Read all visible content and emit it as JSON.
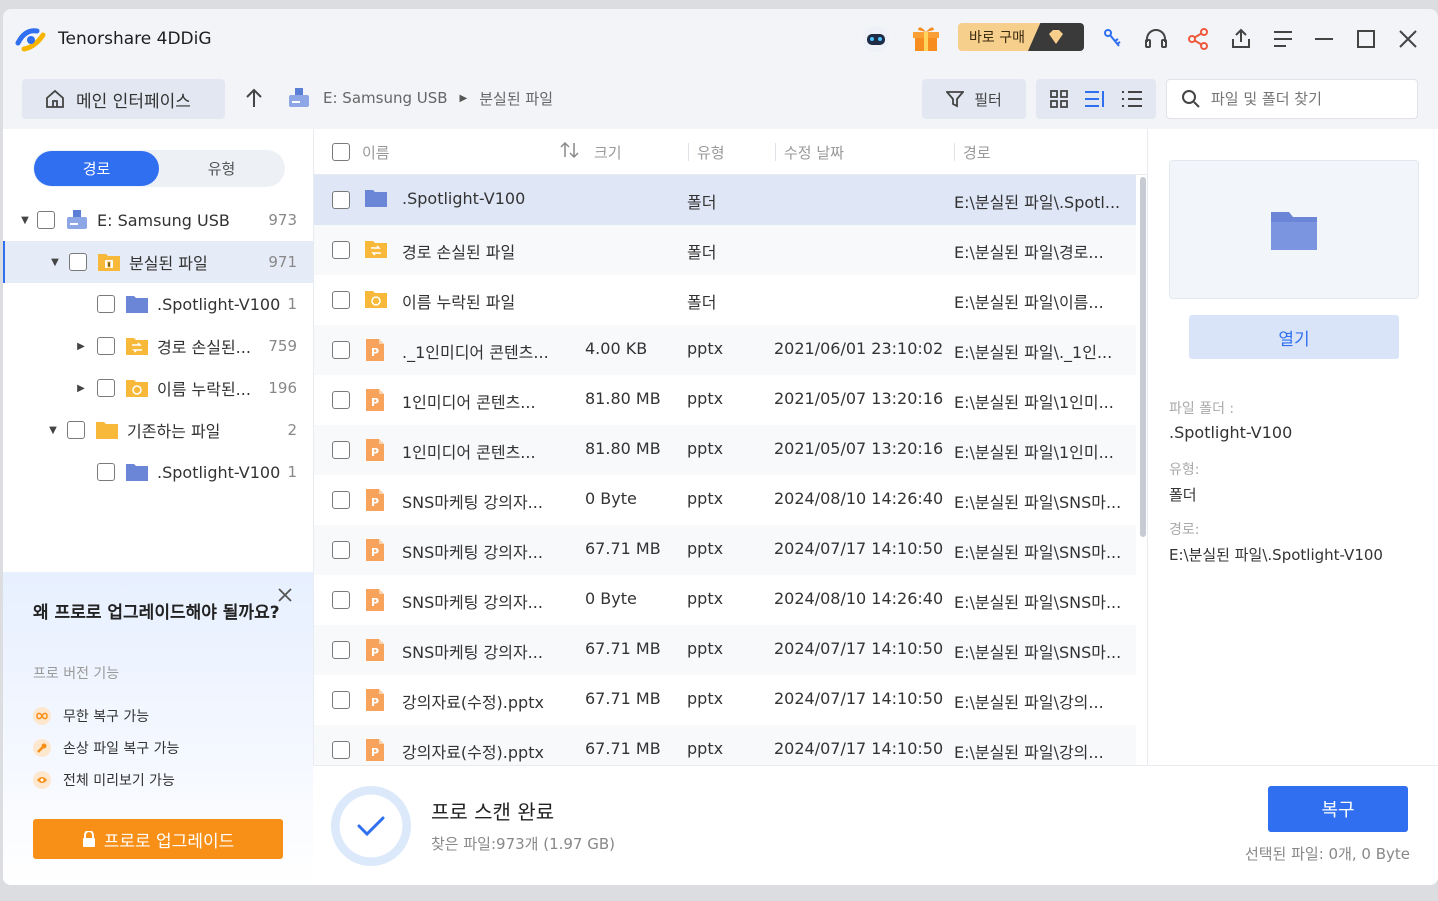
{
  "app": {
    "title": "Tenorshare 4DDiG",
    "buy_label": "바로 구매"
  },
  "toolbar": {
    "home_label": "메인 인터페이스",
    "breadcrumb": [
      "E: Samsung USB",
      "분실된 파일"
    ],
    "filter_label": "필터",
    "search_placeholder": "파일 및 폴더 찾기"
  },
  "left": {
    "tab_path": "경로",
    "tab_type": "유형",
    "tree": [
      {
        "label": "E: Samsung USB",
        "count": "973"
      },
      {
        "label": "분실된 파일",
        "count": "971"
      },
      {
        "label": ".Spotlight-V100",
        "count": "1"
      },
      {
        "label": "경로 손실된...",
        "count": "759"
      },
      {
        "label": "이름 누락된...",
        "count": "196"
      },
      {
        "label": "기존하는 파일",
        "count": "2"
      },
      {
        "label": ".Spotlight-V100",
        "count": "1"
      }
    ],
    "upgrade": {
      "heading": "왜 프로로 업그레이드해야 될까요?",
      "sub": "프로 버전 기능",
      "features": [
        "무한 복구 가능",
        "손상 파일 복구 가능",
        "전체 미리보기 가능"
      ],
      "button": "프로로 업그레이드"
    }
  },
  "table": {
    "headers": [
      "이름",
      "크기",
      "유형",
      "수정 날짜",
      "경로"
    ],
    "rows": [
      {
        "name": ".Spotlight-V100",
        "size": "",
        "type": "폴더",
        "date": "",
        "path": "E:\\분실된 파일\\.Spotl...",
        "icon": "folder-blue"
      },
      {
        "name": "경로 손실된 파일",
        "size": "",
        "type": "폴더",
        "date": "",
        "path": "E:\\분실된 파일\\경로...",
        "icon": "folder-yellow-route"
      },
      {
        "name": "이름 누락된 파일",
        "size": "",
        "type": "폴더",
        "date": "",
        "path": "E:\\분실된 파일\\이름...",
        "icon": "folder-yellow-name"
      },
      {
        "name": "._1인미디어 콘텐츠...",
        "size": "4.00 KB",
        "type": "pptx",
        "date": "2021/06/01 23:10:02",
        "path": "E:\\분실된 파일\\._1인...",
        "icon": "pptx"
      },
      {
        "name": "1인미디어 콘텐츠...",
        "size": "81.80 MB",
        "type": "pptx",
        "date": "2021/05/07 13:20:16",
        "path": "E:\\분실된 파일\\1인미...",
        "icon": "pptx"
      },
      {
        "name": "1인미디어 콘텐츠...",
        "size": "81.80 MB",
        "type": "pptx",
        "date": "2021/05/07 13:20:16",
        "path": "E:\\분실된 파일\\1인미...",
        "icon": "pptx"
      },
      {
        "name": "SNS마케팅 강의자...",
        "size": "0 Byte",
        "type": "pptx",
        "date": "2024/08/10 14:26:40",
        "path": "E:\\분실된 파일\\SNS마...",
        "icon": "pptx"
      },
      {
        "name": "SNS마케팅 강의자...",
        "size": "67.71 MB",
        "type": "pptx",
        "date": "2024/07/17 14:10:50",
        "path": "E:\\분실된 파일\\SNS마...",
        "icon": "pptx"
      },
      {
        "name": "SNS마케팅 강의자...",
        "size": "0 Byte",
        "type": "pptx",
        "date": "2024/08/10 14:26:40",
        "path": "E:\\분실된 파일\\SNS마...",
        "icon": "pptx"
      },
      {
        "name": "SNS마케팅 강의자...",
        "size": "67.71 MB",
        "type": "pptx",
        "date": "2024/07/17 14:10:50",
        "path": "E:\\분실된 파일\\SNS마...",
        "icon": "pptx"
      },
      {
        "name": "강의자료(수정).pptx",
        "size": "67.71 MB",
        "type": "pptx",
        "date": "2024/07/17 14:10:50",
        "path": "E:\\분실된 파일\\강의...",
        "icon": "pptx"
      },
      {
        "name": "강의자료(수정).pptx",
        "size": "67.71 MB",
        "type": "pptx",
        "date": "2024/07/17 14:10:50",
        "path": "E:\\분실된 파일\\강의...",
        "icon": "pptx"
      }
    ]
  },
  "right": {
    "open_label": "열기",
    "folder_label": "파일 폴더 :",
    "folder_value": ".Spotlight-V100",
    "type_label": "유형:",
    "type_value": "폴더",
    "path_label": "경로:",
    "path_value": "E:\\분실된 파일\\.Spotlight-V100"
  },
  "bottom": {
    "status": "프로 스캔 완료",
    "found": "찾은 파일:973개 (1.97 GB)",
    "recover_label": "복구",
    "selected": "선택된 파일: 0개, 0 Byte"
  },
  "colors": {
    "accent": "#2f6ff0",
    "upgrade": "#f88f17",
    "folder_blue": "#6b86d6",
    "folder_yellow": "#f8b93a",
    "pptx": "#f7a35c"
  }
}
